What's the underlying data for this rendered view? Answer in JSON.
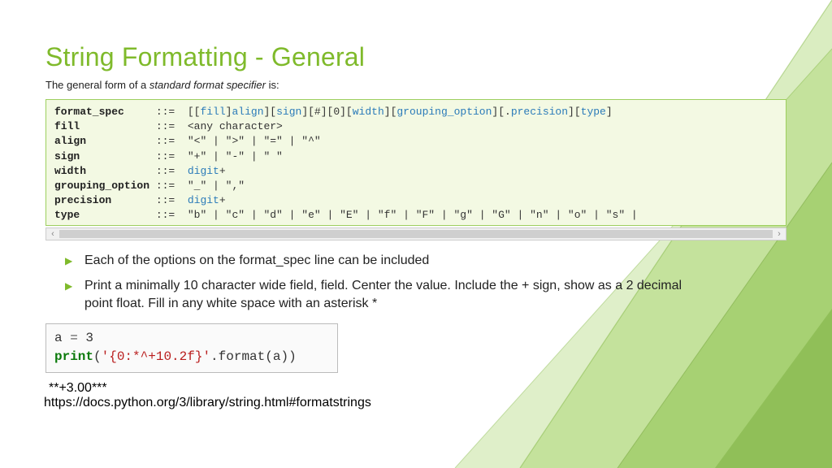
{
  "title": "String Formatting - General",
  "subtitle_pre": "The general form of a ",
  "subtitle_em": "standard format specifier",
  "subtitle_post": " is:",
  "grammar": {
    "format_spec": {
      "name": "format_spec",
      "op": "::=",
      "rhs_tokens": [
        {
          "t": "lit",
          "v": "[["
        },
        {
          "t": "link",
          "v": "fill"
        },
        {
          "t": "lit",
          "v": "]"
        },
        {
          "t": "link",
          "v": "align"
        },
        {
          "t": "lit",
          "v": "]["
        },
        {
          "t": "link",
          "v": "sign"
        },
        {
          "t": "lit",
          "v": "][#][0]["
        },
        {
          "t": "link",
          "v": "width"
        },
        {
          "t": "lit",
          "v": "]["
        },
        {
          "t": "link",
          "v": "grouping_option"
        },
        {
          "t": "lit",
          "v": "][."
        },
        {
          "t": "link",
          "v": "precision"
        },
        {
          "t": "lit",
          "v": "]["
        },
        {
          "t": "link",
          "v": "type"
        },
        {
          "t": "lit",
          "v": "]"
        }
      ]
    },
    "fill": {
      "name": "fill",
      "op": "::=",
      "rhs": "<any character>"
    },
    "align": {
      "name": "align",
      "op": "::=",
      "rhs": "\"<\" | \">\" | \"=\" | \"^\""
    },
    "sign": {
      "name": "sign",
      "op": "::=",
      "rhs": "\"+\" | \"-\" | \" \""
    },
    "width": {
      "name": "width",
      "op": "::=",
      "rhs_tokens": [
        {
          "t": "link",
          "v": "digit"
        },
        {
          "t": "lit",
          "v": "+"
        }
      ]
    },
    "grouping_option": {
      "name": "grouping_option",
      "op": "::=",
      "rhs": "\"_\" | \",\""
    },
    "precision": {
      "name": "precision",
      "op": "::=",
      "rhs_tokens": [
        {
          "t": "link",
          "v": "digit"
        },
        {
          "t": "lit",
          "v": "+"
        }
      ]
    },
    "type": {
      "name": "type",
      "op": "::=",
      "rhs": "\"b\" | \"c\" | \"d\" | \"e\" | \"E\" | \"f\" | \"F\" | \"g\" | \"G\" | \"n\" | \"o\" | \"s\" |"
    }
  },
  "bullets": [
    "Each of the options on the format_spec line can be included",
    "Print a minimally 10 character wide field, field.  Center the value.  Include the + sign, show as a 2 decimal point float.  Fill in any white space with an asterisk *"
  ],
  "code": {
    "line1_a": "a ",
    "line1_op": "=",
    "line1_b": " 3",
    "line2_kw": "print",
    "line2_open": "(",
    "line2_str": "'{0:*^+10.2f}'",
    "line2_rest": ".format(a))"
  },
  "output": "**+3.00***",
  "url": "https://docs.python.org/3/library/string.html#formatstrings"
}
